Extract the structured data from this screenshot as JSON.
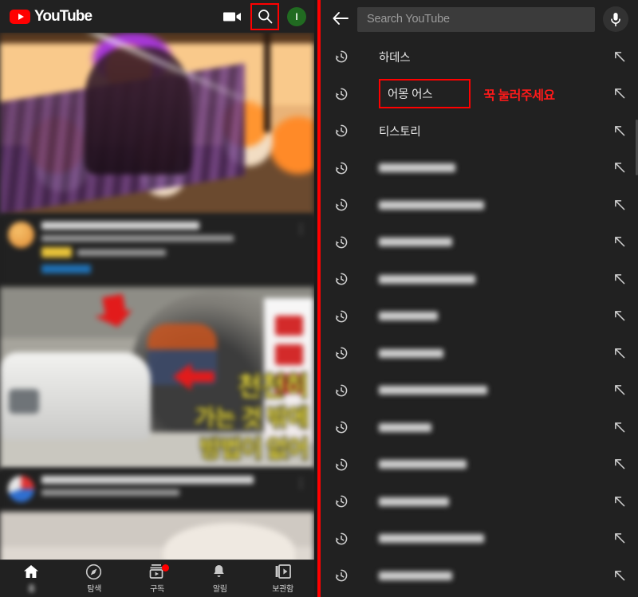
{
  "left": {
    "header": {
      "logo_text": "YouTube",
      "logo_icon": "youtube-play-logo",
      "camera_icon": "video-camera-icon",
      "search_icon": "search-icon",
      "avatar_letter": "I"
    },
    "bottom_nav": [
      {
        "label": "홈",
        "icon": "home-icon",
        "active": true,
        "badge": false
      },
      {
        "label": "탐색",
        "icon": "compass-explore-icon",
        "active": false,
        "badge": false
      },
      {
        "label": "구독",
        "icon": "subscriptions-icon",
        "active": false,
        "badge": true
      },
      {
        "label": "알림",
        "icon": "bell-notification-icon",
        "active": false,
        "badge": false
      },
      {
        "label": "보관함",
        "icon": "library-icon",
        "active": false,
        "badge": false
      }
    ],
    "feed": [
      {
        "thumbnail": "blurred-orange-cartoon-characters-thumbnail",
        "title": "(blurred)",
        "channel": "(blurred)",
        "stats": "(blurred)",
        "avatar": "channel-avatar-orange"
      },
      {
        "thumbnail": "blurred-news-van-tunnel-thumbnail",
        "thumbnail_captions": [
          "천천히",
          "가는 것 밖에",
          "방법이 없어"
        ],
        "title": "(blurred)",
        "channel": "(blurred)",
        "stats": "(blurred)",
        "avatar": "channel-avatar-blue"
      },
      {
        "thumbnail": "blurred-light-scene-thumbnail",
        "title": "(blurred)",
        "channel": "(blurred)",
        "stats": "(blurred)",
        "avatar": "channel-avatar"
      }
    ]
  },
  "right": {
    "search": {
      "back_icon": "back-arrow-icon",
      "placeholder": "Search YouTube",
      "value": "",
      "mic_icon": "microphone-icon"
    },
    "annotation": {
      "text": "꾹 눌러주세요",
      "color": "#ff1a1a",
      "target_index": 1
    },
    "suggestions": [
      {
        "text": "하데스",
        "blurred": false,
        "highlighted": false
      },
      {
        "text": "어몽 어스",
        "blurred": false,
        "highlighted": true
      },
      {
        "text": "티스토리",
        "blurred": false,
        "highlighted": false
      },
      {
        "text": "",
        "blurred": true,
        "highlighted": false,
        "width": "26%"
      },
      {
        "text": "",
        "blurred": true,
        "highlighted": false,
        "width": "36%"
      },
      {
        "text": "",
        "blurred": true,
        "highlighted": false,
        "width": "25%"
      },
      {
        "text": "",
        "blurred": true,
        "highlighted": false,
        "width": "33%"
      },
      {
        "text": "",
        "blurred": true,
        "highlighted": false,
        "width": "20%"
      },
      {
        "text": "",
        "blurred": true,
        "highlighted": false,
        "width": "22%"
      },
      {
        "text": "",
        "blurred": true,
        "highlighted": false,
        "width": "37%"
      },
      {
        "text": "",
        "blurred": true,
        "highlighted": false,
        "width": "18%"
      },
      {
        "text": "",
        "blurred": true,
        "highlighted": false,
        "width": "30%"
      },
      {
        "text": "",
        "blurred": true,
        "highlighted": false,
        "width": "24%"
      },
      {
        "text": "",
        "blurred": true,
        "highlighted": false,
        "width": "36%"
      },
      {
        "text": "",
        "blurred": true,
        "highlighted": false,
        "width": "25%"
      }
    ],
    "history_icon": "history-clock-icon",
    "insert_icon": "arrow-up-left-insert-icon"
  },
  "colors": {
    "youtube_red": "#ff0000",
    "panel_bg": "#212121",
    "annotation_red": "#ff1a1a",
    "divider_red": "#ff0000",
    "avatar_green": "#216b21"
  }
}
